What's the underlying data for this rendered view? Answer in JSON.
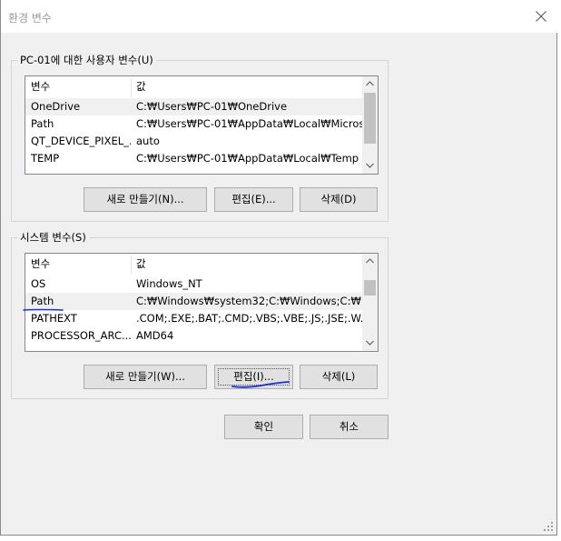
{
  "window": {
    "title": "환경 변수"
  },
  "user_vars": {
    "group_label": "PC-01에 대한 사용자 변수(U)",
    "columns": [
      "변수",
      "값"
    ],
    "rows": [
      {
        "name": "OneDrive",
        "value": "C:₩Users₩PC-01₩OneDrive",
        "selected": true
      },
      {
        "name": "Path",
        "value": "C:₩Users₩PC-01₩AppData₩Local₩Micros...",
        "selected": false
      },
      {
        "name": "QT_DEVICE_PIXEL_...",
        "value": "auto",
        "selected": false
      },
      {
        "name": "TEMP",
        "value": "C:₩Users₩PC-01₩AppData₩Local₩Temp",
        "selected": false
      }
    ],
    "buttons": {
      "new": "새로 만들기(N)...",
      "edit": "편집(E)...",
      "delete": "삭제(D)"
    }
  },
  "system_vars": {
    "group_label": "시스템 변수(S)",
    "columns": [
      "변수",
      "값"
    ],
    "rows": [
      {
        "name": "OS",
        "value": "Windows_NT",
        "selected": false
      },
      {
        "name": "Path",
        "value": "C:₩Windows₩system32;C:₩Windows;C:₩...",
        "selected": true
      },
      {
        "name": "PATHEXT",
        "value": ".COM;.EXE;.BAT;.CMD;.VBS;.VBE;.JS;.JSE;.W...",
        "selected": false
      },
      {
        "name": "PROCESSOR_ARC...",
        "value": "AMD64",
        "selected": false
      }
    ],
    "buttons": {
      "new": "새로 만들기(W)...",
      "edit": "편집(I)...",
      "delete": "삭제(L)"
    }
  },
  "footer": {
    "ok": "확인",
    "cancel": "취소"
  },
  "colors": {
    "annotation": "#1a2fd6",
    "selection": "#f0f0f0"
  },
  "icons": {
    "close": "close-icon",
    "scroll_up": "chevron-up-icon",
    "scroll_down": "chevron-down-icon",
    "resize": "resize-grip-icon"
  }
}
